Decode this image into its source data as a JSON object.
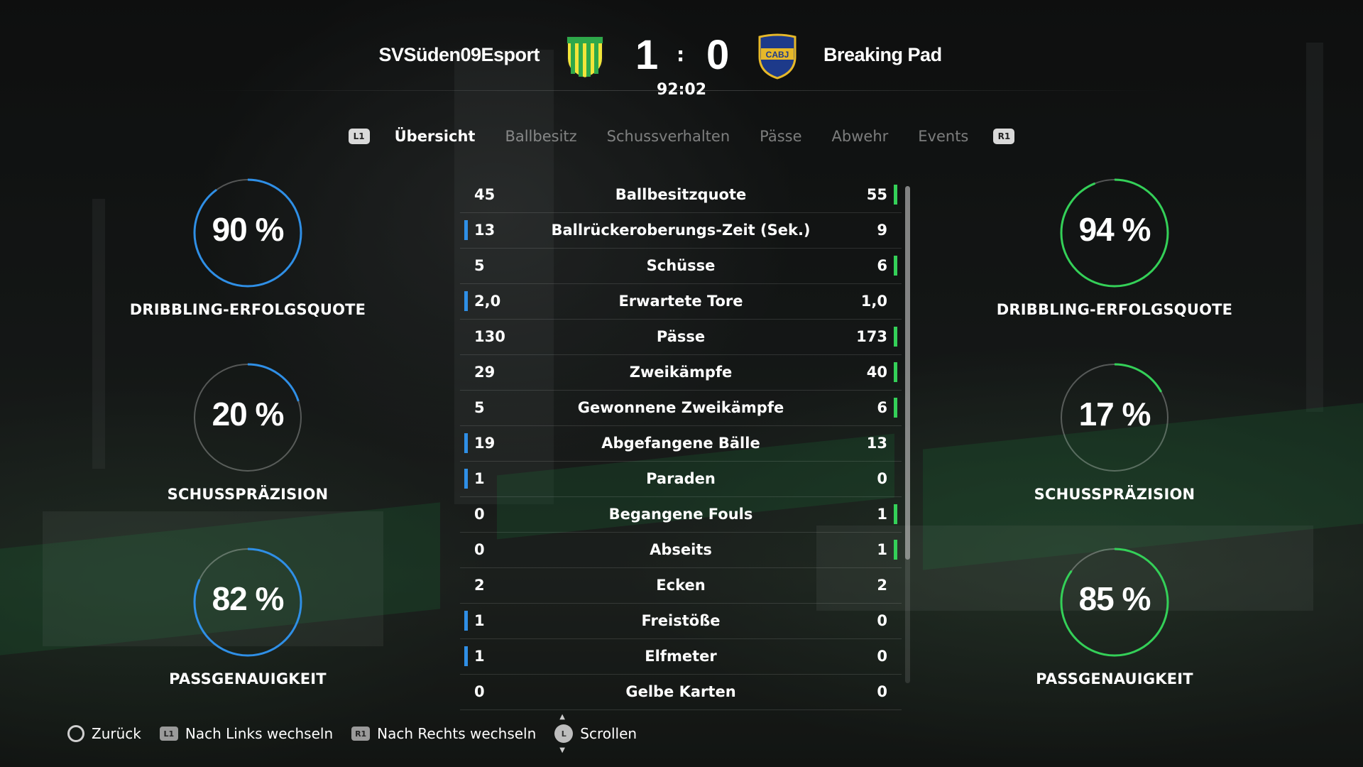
{
  "header": {
    "home_team": "SVSüden09Esport",
    "away_team": "Breaking Pad",
    "home_score": "1",
    "away_score": "0",
    "separator": ":",
    "clock": "92:02",
    "home_crest": "striped-green-yellow-shield-crest",
    "away_crest": "cabj-crest",
    "away_crest_text": "CABJ"
  },
  "tabs": {
    "left_button": "L1",
    "right_button": "R1",
    "items": [
      "Übersicht",
      "Ballbesitz",
      "Schussverhalten",
      "Pässe",
      "Abwehr",
      "Events"
    ],
    "active": "Übersicht"
  },
  "gauges": {
    "home": [
      {
        "value": 90,
        "text": "90 %",
        "label": "DRIBBLING-ERFOLGSQUOTE"
      },
      {
        "value": 20,
        "text": "20 %",
        "label": "SCHUSSPRÄZISION"
      },
      {
        "value": 82,
        "text": "82 %",
        "label": "PASSGENAUIGKEIT"
      }
    ],
    "away": [
      {
        "value": 94,
        "text": "94 %",
        "label": "DRIBBLING-ERFOLGSQUOTE"
      },
      {
        "value": 17,
        "text": "17 %",
        "label": "SCHUSSPRÄZISION"
      },
      {
        "value": 85,
        "text": "85 %",
        "label": "PASSGENAUIGKEIT"
      }
    ],
    "home_color": "#2f8fe6",
    "away_color": "#34d058"
  },
  "stats": [
    {
      "home": "45",
      "label": "Ballbesitzquote",
      "away": "55",
      "leader": "away"
    },
    {
      "home": "13",
      "label": "Ballrückeroberungs-Zeit (Sek.)",
      "away": "9",
      "leader": "home"
    },
    {
      "home": "5",
      "label": "Schüsse",
      "away": "6",
      "leader": "away"
    },
    {
      "home": "2,0",
      "label": "Erwartete Tore",
      "away": "1,0",
      "leader": "home"
    },
    {
      "home": "130",
      "label": "Pässe",
      "away": "173",
      "leader": "away"
    },
    {
      "home": "29",
      "label": "Zweikämpfe",
      "away": "40",
      "leader": "away"
    },
    {
      "home": "5",
      "label": "Gewonnene Zweikämpfe",
      "away": "6",
      "leader": "away"
    },
    {
      "home": "19",
      "label": "Abgefangene Bälle",
      "away": "13",
      "leader": "home"
    },
    {
      "home": "1",
      "label": "Paraden",
      "away": "0",
      "leader": "home"
    },
    {
      "home": "0",
      "label": "Begangene Fouls",
      "away": "1",
      "leader": "away"
    },
    {
      "home": "0",
      "label": "Abseits",
      "away": "1",
      "leader": "away"
    },
    {
      "home": "2",
      "label": "Ecken",
      "away": "2",
      "leader": "none"
    },
    {
      "home": "1",
      "label": "Freistöße",
      "away": "0",
      "leader": "home"
    },
    {
      "home": "1",
      "label": "Elfmeter",
      "away": "0",
      "leader": "home"
    },
    {
      "home": "0",
      "label": "Gelbe Karten",
      "away": "0",
      "leader": "none"
    }
  ],
  "footer": {
    "back_label": "Zurück",
    "left_chip": "L1",
    "left_label": "Nach Links wechseln",
    "right_chip": "R1",
    "right_label": "Nach Rechts wechseln",
    "stick_chip": "L",
    "scroll_label": "Scrollen"
  }
}
